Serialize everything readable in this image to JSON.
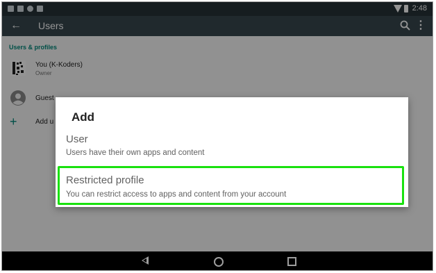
{
  "status_bar": {
    "time": "2:48",
    "notification_icons": [
      "image-icon",
      "media-icon",
      "cloud-icon",
      "photo-icon"
    ],
    "wifi_icon": "wifi-icon",
    "battery_icon": "battery-icon"
  },
  "app_bar": {
    "title": "Users",
    "back_icon": "arrow-back-icon",
    "search_icon": "search-icon",
    "more_icon": "more-vert-icon"
  },
  "users_section": {
    "header": "Users & profiles",
    "rows": [
      {
        "name": "You (K-Koders)",
        "subtitle": "Owner",
        "icon": "user-pattern-avatar"
      },
      {
        "name": "Guest",
        "icon": "account-circle-icon"
      },
      {
        "name": "Add u",
        "icon": "plus-icon"
      }
    ]
  },
  "dialog": {
    "title": "Add",
    "options": [
      {
        "title": "User",
        "description": "Users have their own apps and content"
      },
      {
        "title": "Restricted profile",
        "description": "You can restrict access to apps and content from your account"
      }
    ]
  },
  "nav_bar": {
    "back": "nav-back-icon",
    "home": "nav-home-icon",
    "recents": "nav-recents-icon"
  },
  "colors": {
    "status_bar": "#263238",
    "app_bar": "#37474f",
    "section_accent": "#00897b",
    "highlight": "#19e10e"
  }
}
